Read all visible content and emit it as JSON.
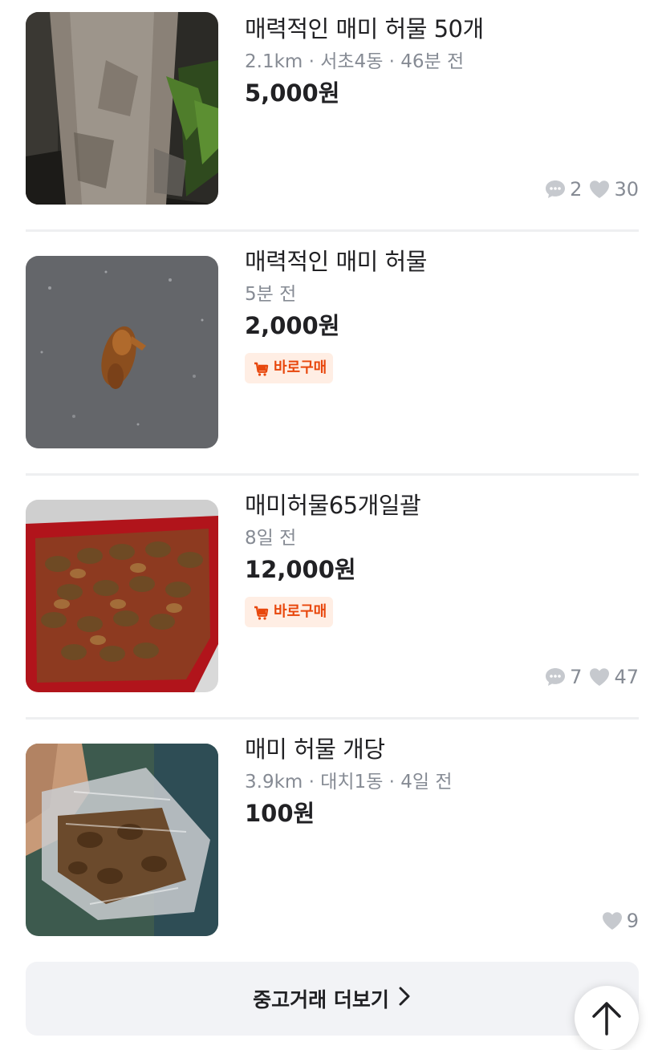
{
  "listings": [
    {
      "title": "매력적인 매미 허물 50개",
      "meta": "2.1km · 서초4동 · 46분 전",
      "price": "5,000원",
      "chats": "2",
      "likes": "30",
      "image": "tree-trunk-photo"
    },
    {
      "title": "매력적인 매미 허물",
      "meta": "5분 전",
      "price": "2,000원",
      "badge": "바로구매",
      "image": "single-shell-on-asphalt-photo"
    },
    {
      "title": "매미허물65개일괄",
      "meta": "8일 전",
      "price": "12,000원",
      "badge": "바로구매",
      "chats": "7",
      "likes": "47",
      "image": "shells-in-red-box-photo"
    },
    {
      "title": "매미 허물 개당",
      "meta": "3.9km · 대치1동 · 4일 전",
      "price": "100원",
      "likes": "9",
      "image": "shells-in-plastic-bag-photo"
    }
  ],
  "more_button": {
    "label": "중고거래 더보기"
  },
  "icons": {
    "chat": "chat-bubble-icon",
    "like": "heart-icon",
    "badge": "cart-icon",
    "more": "chevron-right-icon",
    "fab": "arrow-up-icon"
  },
  "colors": {
    "badge_text": "#e8470c",
    "badge_bg": "#ffeee4",
    "meta_text": "#868b94",
    "divider": "#eeeff1",
    "button_bg": "#f2f3f6"
  }
}
